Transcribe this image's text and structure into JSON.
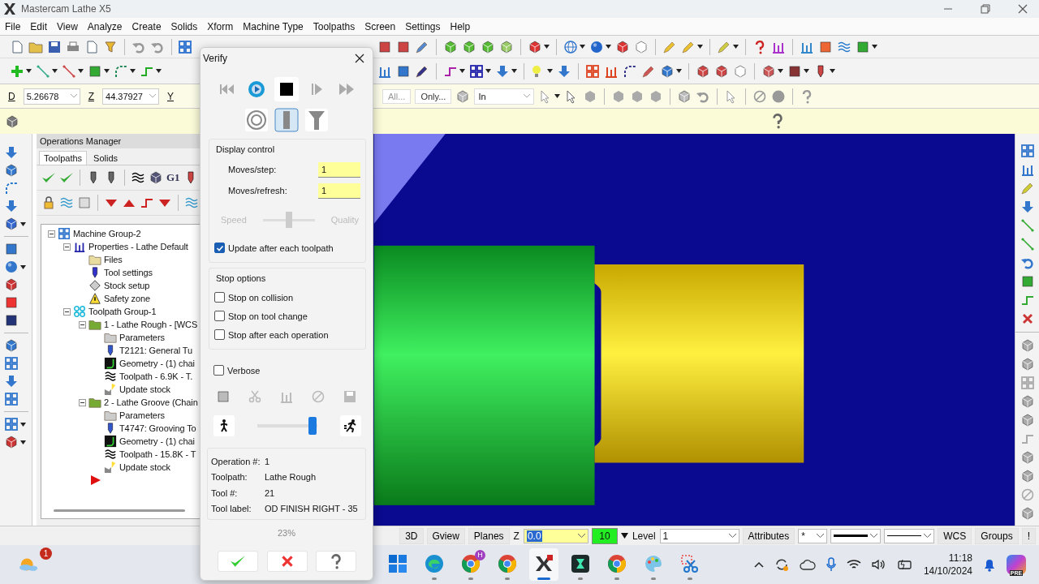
{
  "window": {
    "title": "Mastercam Lathe X5"
  },
  "menu": [
    "File",
    "Edit",
    "View",
    "Analyze",
    "Create",
    "Solids",
    "Xform",
    "Machine Type",
    "Toolpaths",
    "Screen",
    "Settings",
    "Help"
  ],
  "coordinate_bar": {
    "fields": [
      {
        "label": "D",
        "value": "5.26678"
      },
      {
        "label": "Z",
        "value": "44.37927"
      },
      {
        "label": "Y"
      }
    ],
    "buttons": [
      "All...",
      "Only..."
    ],
    "dropdown": "In"
  },
  "operations_manager": {
    "title": "Operations Manager",
    "tabs": [
      {
        "label": "Toolpaths",
        "selected": true
      },
      {
        "label": "Solids",
        "selected": false
      }
    ],
    "g_code_button": "G1",
    "tree": [
      {
        "label": "Machine Group-2",
        "kind": "machine-group",
        "expanded": true,
        "children": [
          {
            "label": "Properties - Lathe Default",
            "kind": "properties",
            "expanded": true,
            "children": [
              {
                "label": "Files",
                "kind": "folder"
              },
              {
                "label": "Tool settings",
                "kind": "tool"
              },
              {
                "label": "Stock setup",
                "kind": "stock"
              },
              {
                "label": "Safety zone",
                "kind": "safety"
              }
            ]
          },
          {
            "label": "Toolpath Group-1",
            "kind": "toolpath-group",
            "expanded": true,
            "children": [
              {
                "label": "1 - Lathe Rough - [WCS",
                "kind": "operation",
                "expanded": true,
                "children": [
                  {
                    "label": "Parameters",
                    "kind": "parameters"
                  },
                  {
                    "label": "T2121: General Tu",
                    "kind": "tool-def"
                  },
                  {
                    "label": "Geometry - (1) chai",
                    "kind": "geometry"
                  },
                  {
                    "label": "Toolpath - 6.9K - T.",
                    "kind": "toolpath"
                  },
                  {
                    "label": "Update stock",
                    "kind": "update-stock"
                  }
                ]
              },
              {
                "label": "2 - Lathe Groove (Chain",
                "kind": "operation",
                "expanded": true,
                "children": [
                  {
                    "label": "Parameters",
                    "kind": "parameters"
                  },
                  {
                    "label": "T4747: Grooving To",
                    "kind": "tool-def"
                  },
                  {
                    "label": "Geometry - (1) chai",
                    "kind": "geometry"
                  },
                  {
                    "label": "Toolpath - 15.8K - T",
                    "kind": "toolpath"
                  },
                  {
                    "label": "Update stock",
                    "kind": "update-stock"
                  }
                ]
              }
            ]
          }
        ]
      }
    ]
  },
  "verify": {
    "title": "Verify",
    "display_control": {
      "title": "Display control",
      "fields": [
        {
          "label": "Moves/step:",
          "value": "1"
        },
        {
          "label": "Moves/refresh:",
          "value": "1"
        }
      ],
      "slider": {
        "start": "Speed",
        "end": "Quality",
        "level": 0.5,
        "disabled": true
      },
      "option": {
        "label": "Update after each toolpath",
        "checked": true
      }
    },
    "stop_options": {
      "title": "Stop options",
      "options": [
        {
          "label": "Stop on collision",
          "checked": false
        },
        {
          "label": "Stop on tool change",
          "checked": false
        },
        {
          "label": "Stop after each operation",
          "checked": false
        }
      ]
    },
    "verbose": {
      "label": "Verbose",
      "checked": false
    },
    "speed": {
      "level": 0.92
    },
    "info": [
      {
        "label": "Operation #:",
        "value": "1"
      },
      {
        "label": "Toolpath:",
        "value": "Lathe Rough"
      },
      {
        "label": "Tool #:",
        "value": "21"
      },
      {
        "label": "Tool label:",
        "value": "OD FINISH RIGHT - 35"
      }
    ],
    "progress": "23%"
  },
  "status_bar": [
    {
      "kind": "button",
      "text": "3D"
    },
    {
      "kind": "button",
      "text": "Gview"
    },
    {
      "kind": "button",
      "text": "Planes"
    },
    {
      "kind": "label",
      "text": "Z"
    },
    {
      "kind": "value-combo",
      "text": "0.0",
      "highlighted": true
    },
    {
      "kind": "color-box",
      "text": "10"
    },
    {
      "kind": "label",
      "text": "Level"
    },
    {
      "kind": "combo",
      "text": "1"
    },
    {
      "kind": "button",
      "text": "Attributes"
    },
    {
      "kind": "point-combo",
      "text": "*"
    },
    {
      "kind": "line-combo",
      "thick": true
    },
    {
      "kind": "line-combo",
      "thick": false
    },
    {
      "kind": "button",
      "text": "WCS"
    },
    {
      "kind": "button",
      "text": "Groups"
    },
    {
      "kind": "button",
      "text": "!"
    }
  ],
  "taskbar": {
    "weather_badge": "1",
    "apps": [
      {
        "kind": "start",
        "running": false,
        "selected": false
      },
      {
        "kind": "edge",
        "running": true,
        "selected": false
      },
      {
        "kind": "chrome",
        "running": true,
        "selected": false,
        "badge": "H"
      },
      {
        "kind": "chrome",
        "running": true,
        "selected": false
      },
      {
        "kind": "mastercam",
        "running": true,
        "selected": true
      },
      {
        "kind": "filmora",
        "running": true,
        "selected": false
      },
      {
        "kind": "chrome",
        "running": true,
        "selected": false
      },
      {
        "kind": "paint",
        "running": true,
        "selected": false
      },
      {
        "kind": "snip",
        "running": true,
        "selected": false
      }
    ],
    "time": "11:18",
    "date": "14/10/2024",
    "copilot_label": "PRE"
  }
}
